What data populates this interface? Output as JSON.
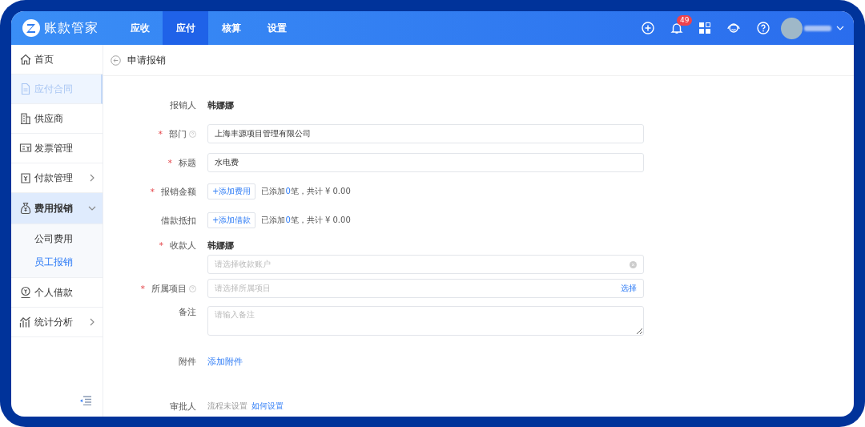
{
  "brand": {
    "name": "账款管家"
  },
  "nav_tabs": [
    {
      "label": "应收",
      "selected": false
    },
    {
      "label": "应付",
      "selected": true
    },
    {
      "label": "核算",
      "selected": false
    },
    {
      "label": "设置",
      "selected": false
    }
  ],
  "notifications": {
    "badge": "49"
  },
  "sidebar": {
    "items": [
      {
        "label": "首页",
        "dimmed": false,
        "expanded": false,
        "has_children": false
      },
      {
        "label": "应付合同",
        "dimmed": true,
        "expanded": false,
        "has_children": false
      },
      {
        "label": "供应商",
        "dimmed": false,
        "expanded": false,
        "has_children": false
      },
      {
        "label": "发票管理",
        "dimmed": false,
        "expanded": false,
        "has_children": false
      },
      {
        "label": "付款管理",
        "dimmed": false,
        "expanded": false,
        "has_children": true
      },
      {
        "label": "费用报销",
        "dimmed": false,
        "expanded": true,
        "has_children": true,
        "children": [
          {
            "label": "公司费用",
            "selected": false
          },
          {
            "label": "员工报销",
            "selected": true
          }
        ]
      },
      {
        "label": "个人借款",
        "dimmed": false,
        "expanded": false,
        "has_children": false
      },
      {
        "label": "统计分析",
        "dimmed": false,
        "expanded": false,
        "has_children": true
      }
    ]
  },
  "page": {
    "title": "申请报销"
  },
  "form": [
    {
      "kind": "text",
      "label": "报销人",
      "help": false,
      "value": "韩娜娜"
    },
    {
      "kind": "input",
      "required_mark": "*",
      "label": "部门",
      "help": true,
      "value": "上海丰源项目管理有限公司"
    },
    {
      "kind": "input",
      "required_mark": "*",
      "label": "标题",
      "help": false,
      "value": "水电费"
    },
    {
      "kind": "amount",
      "required_mark": "*",
      "label": "报销金额",
      "help": false,
      "button": "+添加费用",
      "prefix": "已添加",
      "count": "0",
      "suffix": "笔，共计 ¥ 0.00"
    },
    {
      "kind": "amount",
      "label": "借款抵扣",
      "help": false,
      "button": "+添加借款",
      "prefix": "已添加",
      "count": "0",
      "suffix": "笔，共计 ¥ 0.00"
    },
    {
      "kind": "payee",
      "required_mark": "*",
      "label": "收款人",
      "help": false,
      "value": "韩娜娜",
      "placeholder": "请选择收款账户"
    },
    {
      "kind": "picker",
      "required_mark": "*",
      "label": "所属项目",
      "help": true,
      "placeholder": "请选择所属项目",
      "action": "选择"
    },
    {
      "kind": "textarea",
      "label": "备注",
      "help": false,
      "placeholder": "请输入备注"
    },
    {
      "kind": "link",
      "label": "附件",
      "help": false,
      "link": "添加附件"
    },
    {
      "kind": "approver",
      "label": "审批人",
      "help": false,
      "note": "流程未设置",
      "link": "如何设置"
    }
  ]
}
